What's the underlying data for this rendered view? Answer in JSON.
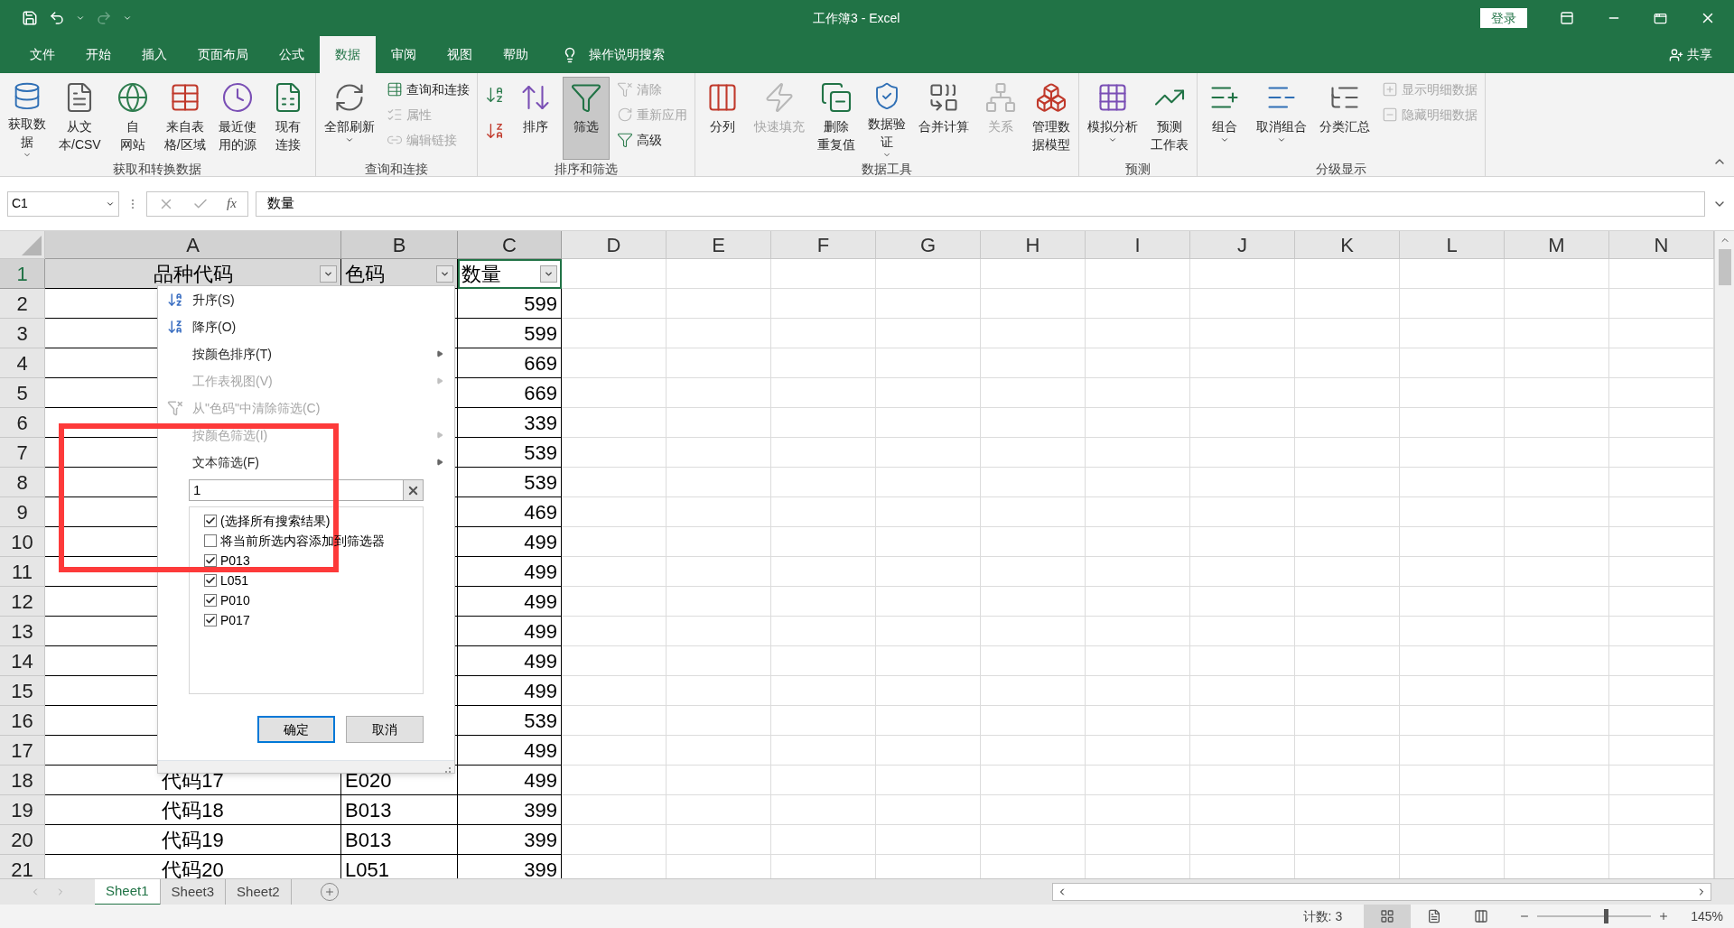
{
  "window": {
    "title": "工作簿3  -  Excel",
    "sign_in": "登录"
  },
  "menu_tabs": [
    {
      "label": "文件",
      "selected": false
    },
    {
      "label": "开始",
      "selected": false
    },
    {
      "label": "插入",
      "selected": false
    },
    {
      "label": "页面布局",
      "selected": false
    },
    {
      "label": "公式",
      "selected": false
    },
    {
      "label": "数据",
      "selected": true
    },
    {
      "label": "审阅",
      "selected": false
    },
    {
      "label": "视图",
      "selected": false
    },
    {
      "label": "帮助",
      "selected": false
    }
  ],
  "tell_me": "操作说明搜索",
  "share": "共享",
  "ribbon": {
    "groups": [
      {
        "label": "获取和转换数据",
        "buttons": [
          {
            "kind": "large",
            "label": [
              "获取数",
              "据"
            ],
            "dropdown": true,
            "disabled": false
          },
          {
            "kind": "large",
            "label": [
              "从文",
              "本/CSV"
            ],
            "dropdown": false,
            "disabled": false
          },
          {
            "kind": "large",
            "label": [
              "自",
              "网站"
            ],
            "dropdown": false,
            "disabled": false
          },
          {
            "kind": "large",
            "label": [
              "来自表",
              "格/区域"
            ],
            "dropdown": false,
            "disabled": false
          },
          {
            "kind": "large",
            "label": [
              "最近使",
              "用的源"
            ],
            "dropdown": false,
            "disabled": false
          },
          {
            "kind": "large",
            "label": [
              "现有",
              "连接"
            ],
            "dropdown": false,
            "disabled": false
          }
        ]
      },
      {
        "label": "查询和连接",
        "buttons": [
          {
            "kind": "large",
            "label": [
              "全部刷新"
            ],
            "dropdown": true,
            "disabled": false
          },
          {
            "kind": "small",
            "label": "查询和连接",
            "disabled": false
          },
          {
            "kind": "small",
            "label": "属性",
            "disabled": true
          },
          {
            "kind": "small",
            "label": "编辑链接",
            "disabled": true
          }
        ]
      },
      {
        "label": "排序和筛选",
        "buttons": [
          {
            "kind": "icon",
            "disabled": false
          },
          {
            "kind": "icon",
            "disabled": false
          },
          {
            "kind": "large",
            "label": [
              "排序"
            ],
            "dropdown": false,
            "disabled": false,
            "selected": false
          },
          {
            "kind": "large",
            "label": [
              "筛选"
            ],
            "dropdown": false,
            "disabled": false,
            "selected": true
          },
          {
            "kind": "small",
            "label": "清除",
            "disabled": true
          },
          {
            "kind": "small",
            "label": "重新应用",
            "disabled": true
          },
          {
            "kind": "small",
            "label": "高级",
            "disabled": false
          }
        ]
      },
      {
        "label": "数据工具",
        "buttons": [
          {
            "kind": "large",
            "label": [
              "分列"
            ],
            "dropdown": false,
            "disabled": false
          },
          {
            "kind": "large",
            "label": [
              "快速填充"
            ],
            "dropdown": false,
            "disabled": true
          },
          {
            "kind": "large",
            "label": [
              "删除",
              "重复值"
            ],
            "dropdown": false,
            "disabled": false
          },
          {
            "kind": "large",
            "label": [
              "数据验",
              "证"
            ],
            "dropdown": true,
            "disabled": false
          },
          {
            "kind": "large",
            "label": [
              "合并计算"
            ],
            "dropdown": false,
            "disabled": false
          },
          {
            "kind": "large",
            "label": [
              "关系"
            ],
            "dropdown": false,
            "disabled": true
          },
          {
            "kind": "large",
            "label": [
              "管理数",
              "据模型"
            ],
            "dropdown": false,
            "disabled": false
          }
        ]
      },
      {
        "label": "预测",
        "buttons": [
          {
            "kind": "large",
            "label": [
              "模拟分析"
            ],
            "dropdown": true,
            "disabled": false
          },
          {
            "kind": "large",
            "label": [
              "预测",
              "工作表"
            ],
            "dropdown": false,
            "disabled": false
          }
        ]
      },
      {
        "label": "分级显示",
        "buttons": [
          {
            "kind": "large",
            "label": [
              "组合"
            ],
            "dropdown": true,
            "disabled": false
          },
          {
            "kind": "large",
            "label": [
              "取消组合"
            ],
            "dropdown": true,
            "disabled": false
          },
          {
            "kind": "large",
            "label": [
              "分类汇总"
            ],
            "dropdown": false,
            "disabled": false
          },
          {
            "kind": "small",
            "label": "显示明细数据",
            "disabled": true
          },
          {
            "kind": "small",
            "label": "隐藏明细数据",
            "disabled": true
          }
        ]
      }
    ]
  },
  "formula_bar": {
    "name_box": "C1",
    "function_label": "fx",
    "value": "数量"
  },
  "columns": [
    {
      "label": "A",
      "selected": true
    },
    {
      "label": "B",
      "selected": true
    },
    {
      "label": "C",
      "selected": true
    },
    {
      "label": "D",
      "selected": false
    },
    {
      "label": "E",
      "selected": false
    },
    {
      "label": "F",
      "selected": false
    },
    {
      "label": "G",
      "selected": false
    },
    {
      "label": "H",
      "selected": false
    },
    {
      "label": "I",
      "selected": false
    },
    {
      "label": "J",
      "selected": false
    },
    {
      "label": "K",
      "selected": false
    },
    {
      "label": "L",
      "selected": false
    },
    {
      "label": "M",
      "selected": false
    },
    {
      "label": "N",
      "selected": false
    }
  ],
  "header_row": {
    "number": "1",
    "selected": true,
    "cells": [
      "品种代码",
      "色码",
      "数量"
    ]
  },
  "rows": [
    {
      "number": "2",
      "selected": false,
      "quantity": "599"
    },
    {
      "number": "3",
      "selected": false,
      "quantity": "599"
    },
    {
      "number": "4",
      "selected": false,
      "quantity": "669"
    },
    {
      "number": "5",
      "selected": false,
      "quantity": "669"
    },
    {
      "number": "6",
      "selected": false,
      "quantity": "339"
    },
    {
      "number": "7",
      "selected": false,
      "quantity": "539"
    },
    {
      "number": "8",
      "selected": false,
      "quantity": "539"
    },
    {
      "number": "9",
      "selected": false,
      "quantity": "469"
    },
    {
      "number": "10",
      "selected": false,
      "quantity": "499"
    },
    {
      "number": "11",
      "selected": false,
      "quantity": "499"
    },
    {
      "number": "12",
      "selected": false,
      "quantity": "499"
    },
    {
      "number": "13",
      "selected": false,
      "quantity": "499"
    },
    {
      "number": "14",
      "selected": false,
      "quantity": "499"
    },
    {
      "number": "15",
      "selected": false,
      "quantity": "499"
    },
    {
      "number": "16",
      "selected": false,
      "quantity": "539"
    },
    {
      "number": "17",
      "selected": false,
      "quantity": "499"
    },
    {
      "number": "18",
      "selected": false,
      "code": "代码17",
      "color_code": "E020",
      "quantity": "499"
    },
    {
      "number": "19",
      "selected": false,
      "code": "代码18",
      "color_code": "B013",
      "quantity": "399"
    },
    {
      "number": "20",
      "selected": false,
      "code": "代码19",
      "color_code": "B013",
      "quantity": "399"
    },
    {
      "number": "21",
      "selected": false,
      "code": "代码20",
      "color_code": "L051",
      "quantity": "399"
    }
  ],
  "filter_menu": {
    "items": [
      {
        "label": "升序(S)",
        "disabled": false,
        "submenu": false
      },
      {
        "label": "降序(O)",
        "disabled": false,
        "submenu": false
      },
      {
        "label": "按颜色排序(T)",
        "disabled": false,
        "submenu": true
      },
      {
        "label": "工作表视图(V)",
        "disabled": true,
        "submenu": true
      },
      {
        "label": "从\"色码\"中清除筛选(C)",
        "disabled": true,
        "submenu": false
      },
      {
        "label": "按颜色筛选(I)",
        "disabled": true,
        "submenu": true
      },
      {
        "label": "文本筛选(F)",
        "disabled": false,
        "submenu": true
      }
    ],
    "search_value": "1",
    "options": [
      {
        "label": "(选择所有搜索结果)",
        "checked": true
      },
      {
        "label": "将当前所选内容添加到筛选器",
        "checked": false
      },
      {
        "label": "P013",
        "checked": true
      },
      {
        "label": "L051",
        "checked": true
      },
      {
        "label": "P010",
        "checked": true
      },
      {
        "label": "P017",
        "checked": true
      }
    ],
    "ok": "确定",
    "cancel": "取消"
  },
  "sheet_tabs": [
    {
      "label": "Sheet1",
      "selected": true
    },
    {
      "label": "Sheet3",
      "selected": false
    },
    {
      "label": "Sheet2",
      "selected": false
    }
  ],
  "status_bar": {
    "summary": "计数: 3",
    "views": [
      {
        "selected": true
      },
      {
        "selected": false
      },
      {
        "selected": false
      }
    ],
    "zoom": {
      "level": 0.6,
      "reading": "145%"
    }
  }
}
